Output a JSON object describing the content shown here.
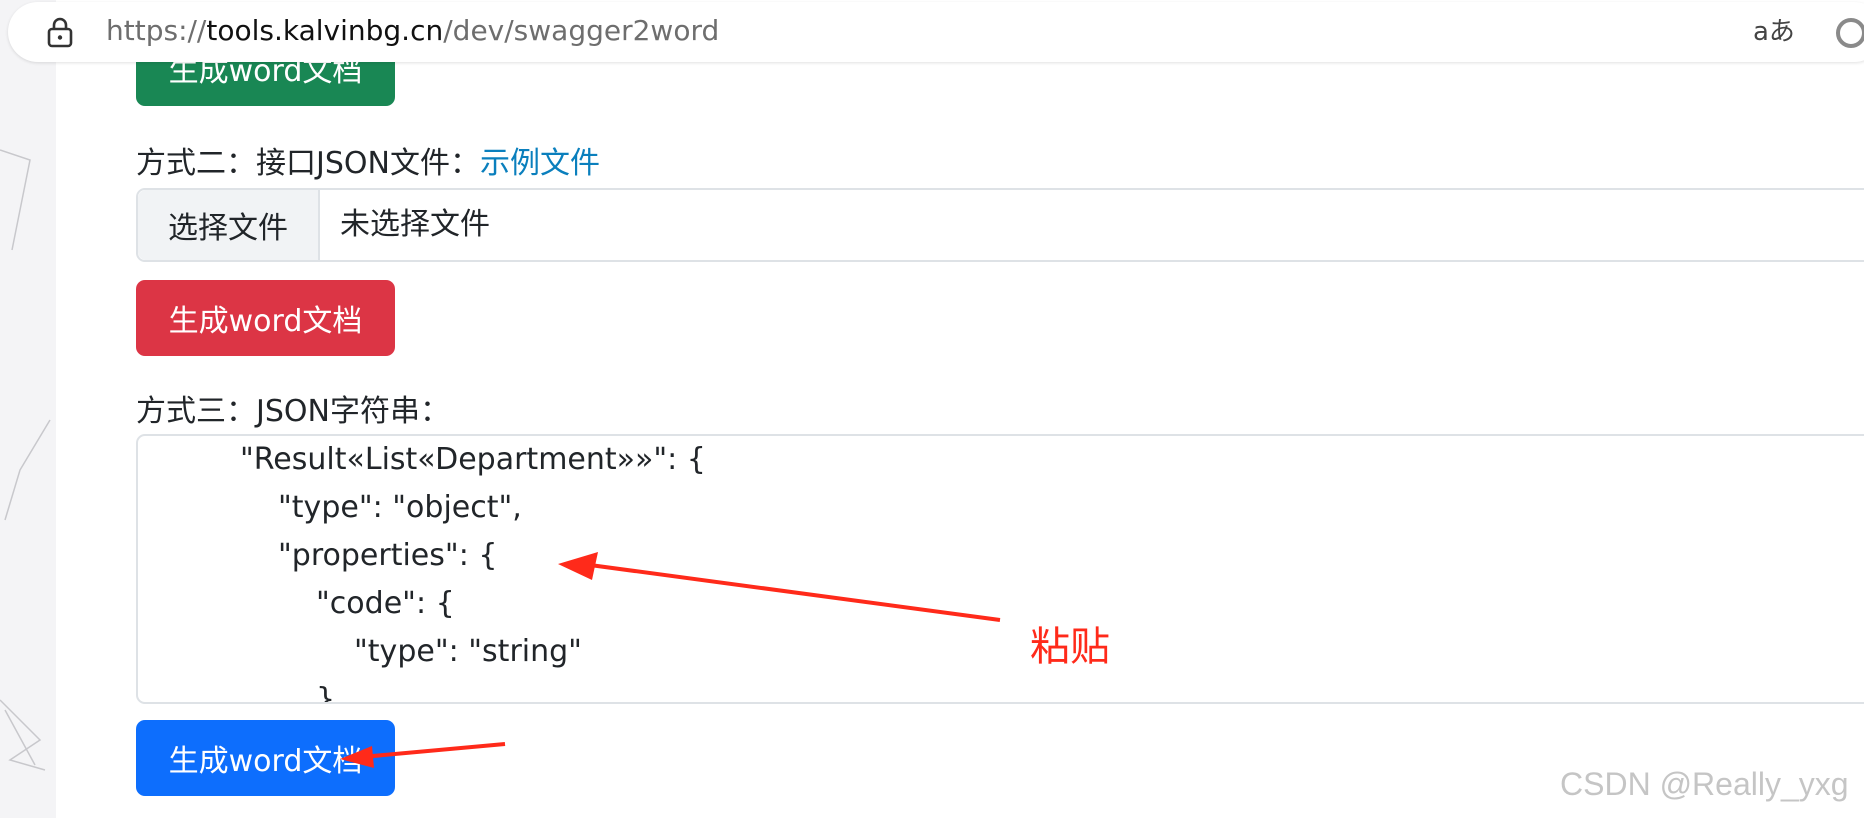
{
  "browser": {
    "url_scheme": "https://",
    "url_host": "tools.kalvinbg.cn",
    "url_path": "/dev/swagger2word",
    "read_aloud_label": "aあ"
  },
  "buttons": {
    "generate_1": "生成word文档",
    "generate_2": "生成word文档",
    "generate_3": "生成word文档"
  },
  "method2": {
    "label": "方式二：接口JSON文件：",
    "example_link": "示例文件",
    "choose_file_button": "选择文件",
    "file_status": "未选择文件"
  },
  "method3": {
    "label": "方式三：JSON字符串：",
    "json_lines": [
      "\"Result«List«Department»»\": {",
      "\"type\": \"object\",",
      "\"properties\": {",
      "\"code\": {",
      "\"type\": \"string\"",
      "}"
    ]
  },
  "annotation": {
    "note": "粘贴"
  },
  "watermark": "CSDN @Really_yxg",
  "colors": {
    "green_button": "#198754",
    "red_button": "#dc3545",
    "blue_button": "#0d6efd",
    "link": "#0a7fbd",
    "annotation_red": "#ff2a1a"
  }
}
